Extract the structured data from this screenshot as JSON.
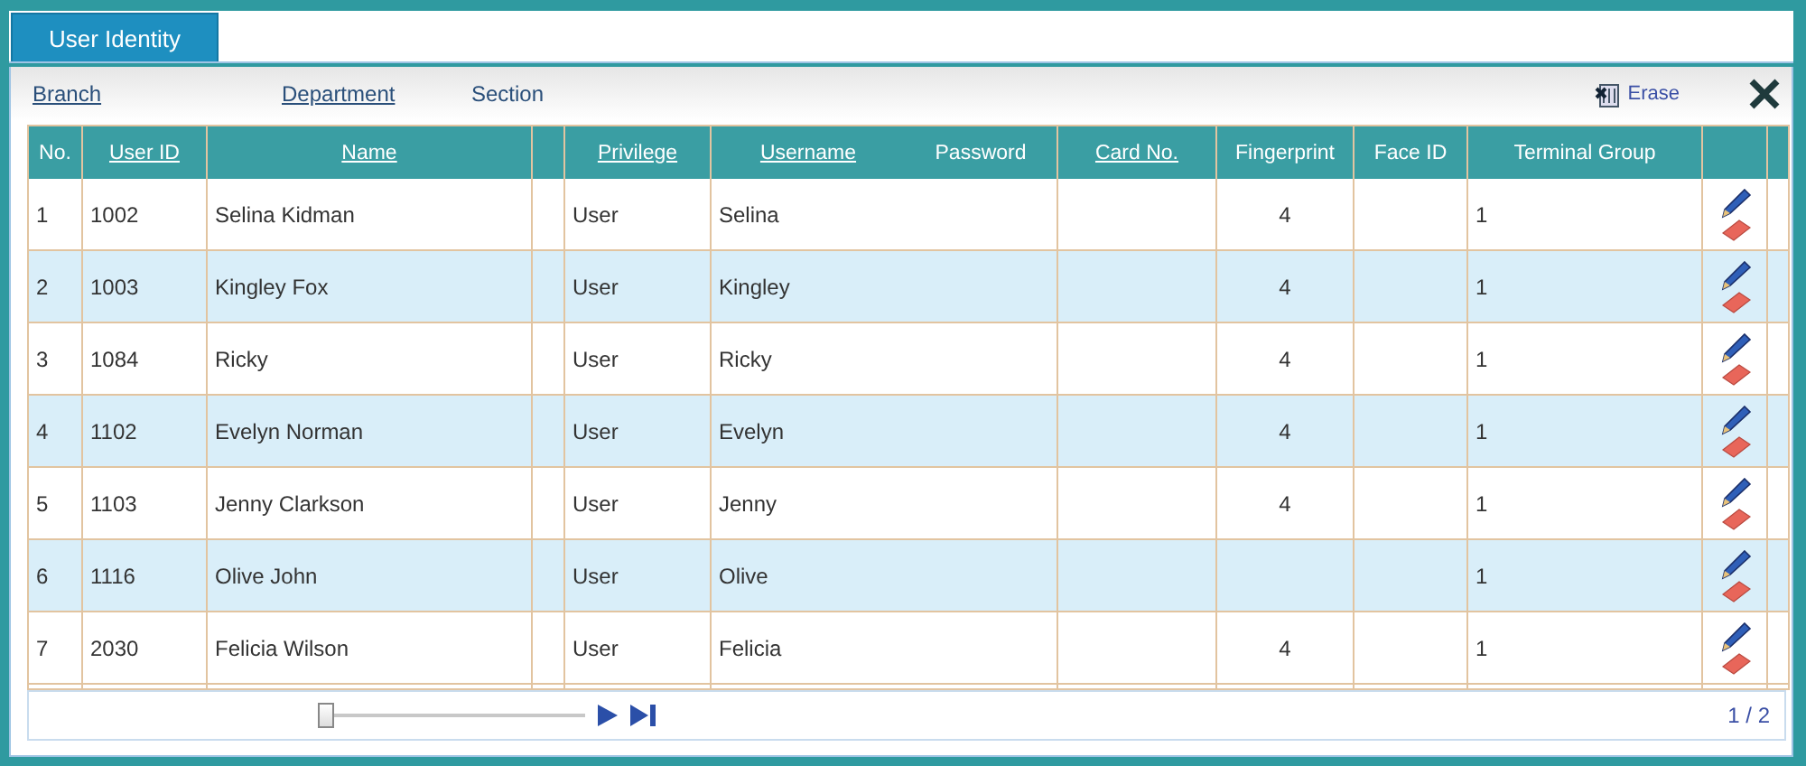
{
  "tabs": [
    {
      "label": "User Identity",
      "selected": true
    }
  ],
  "filters": [
    {
      "label": "Branch",
      "link": true
    },
    {
      "label": "Department",
      "link": true
    },
    {
      "label": "Section",
      "link": false
    }
  ],
  "toolbar": {
    "erase": "Erase"
  },
  "table": {
    "columns": [
      {
        "label": "No.",
        "link": false
      },
      {
        "label": "User ID",
        "link": true
      },
      {
        "label": "Name",
        "link": true
      },
      {
        "kind": "blank"
      },
      {
        "label": "Privilege",
        "link": true
      },
      {
        "label": "Username",
        "link": true
      },
      {
        "label": "Password",
        "link": false
      },
      {
        "label": "Card No.",
        "link": true
      },
      {
        "label": "Fingerprint",
        "link": false
      },
      {
        "label": "Face ID",
        "link": false
      },
      {
        "label": "Terminal Group",
        "link": false
      },
      {
        "kind": "actions"
      },
      {
        "kind": "blank"
      }
    ],
    "rows": [
      {
        "no": "1",
        "user_id": "1002",
        "name": "Selina Kidman",
        "privilege": "User",
        "username": "Selina",
        "fingerprint": "4",
        "terminal_group": "1"
      },
      {
        "no": "2",
        "user_id": "1003",
        "name": "Kingley Fox",
        "privilege": "User",
        "username": "Kingley",
        "fingerprint": "4",
        "terminal_group": "1"
      },
      {
        "no": "3",
        "user_id": "1084",
        "name": "Ricky",
        "privilege": "User",
        "username": "Ricky",
        "fingerprint": "4",
        "terminal_group": "1"
      },
      {
        "no": "4",
        "user_id": "1102",
        "name": "Evelyn Norman",
        "privilege": "User",
        "username": "Evelyn",
        "fingerprint": "4",
        "terminal_group": "1"
      },
      {
        "no": "5",
        "user_id": "1103",
        "name": "Jenny Clarkson",
        "privilege": "User",
        "username": "Jenny",
        "fingerprint": "4",
        "terminal_group": "1"
      },
      {
        "no": "6",
        "user_id": "1116",
        "name": "Olive John",
        "privilege": "User",
        "username": "Olive",
        "terminal_group": "1"
      },
      {
        "no": "7",
        "user_id": "2030",
        "name": "Felicia Wilson",
        "privilege": "User",
        "username": "Felicia",
        "fingerprint": "4",
        "terminal_group": "1"
      }
    ]
  },
  "pager": {
    "level": 0,
    "page": "1 / 2"
  }
}
